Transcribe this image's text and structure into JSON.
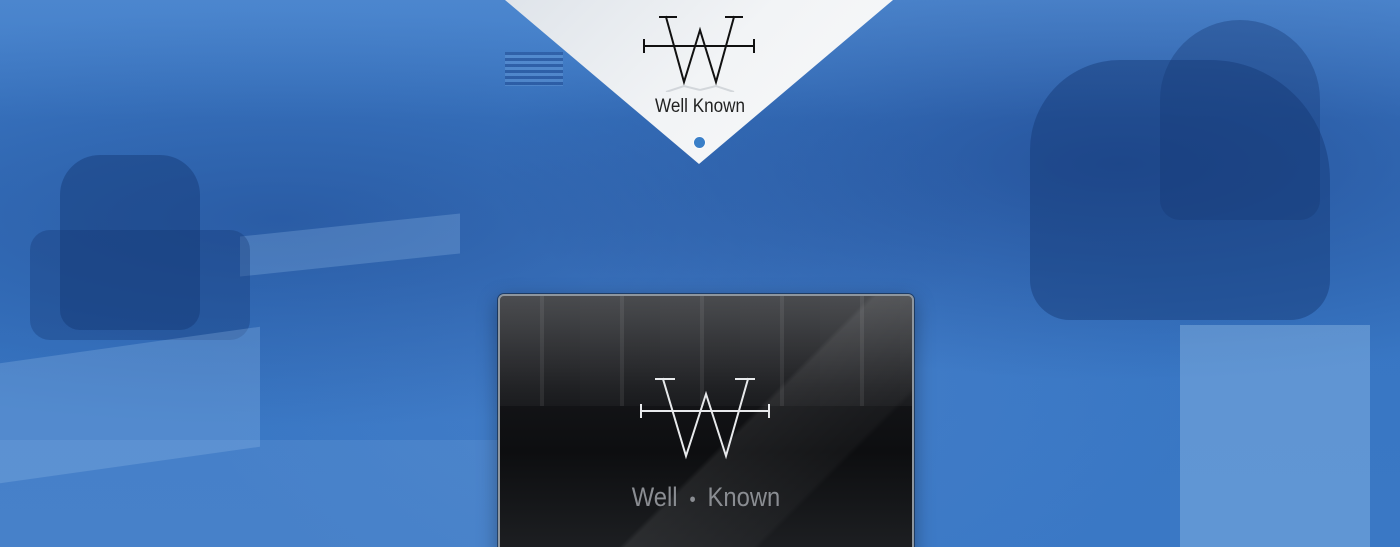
{
  "brand": {
    "name": "Well Known",
    "card_name_left": "Well",
    "card_separator": "•",
    "card_name_right": "Known"
  },
  "colors": {
    "background": "#3a78c4",
    "chevron": "#f2f4f6",
    "dot": "#3a7fc8",
    "card": "#141518",
    "card_text": "#8a8d92"
  },
  "icons": {
    "top_logo": "w-monogram-logo",
    "card_logo": "w-monogram-logo"
  }
}
